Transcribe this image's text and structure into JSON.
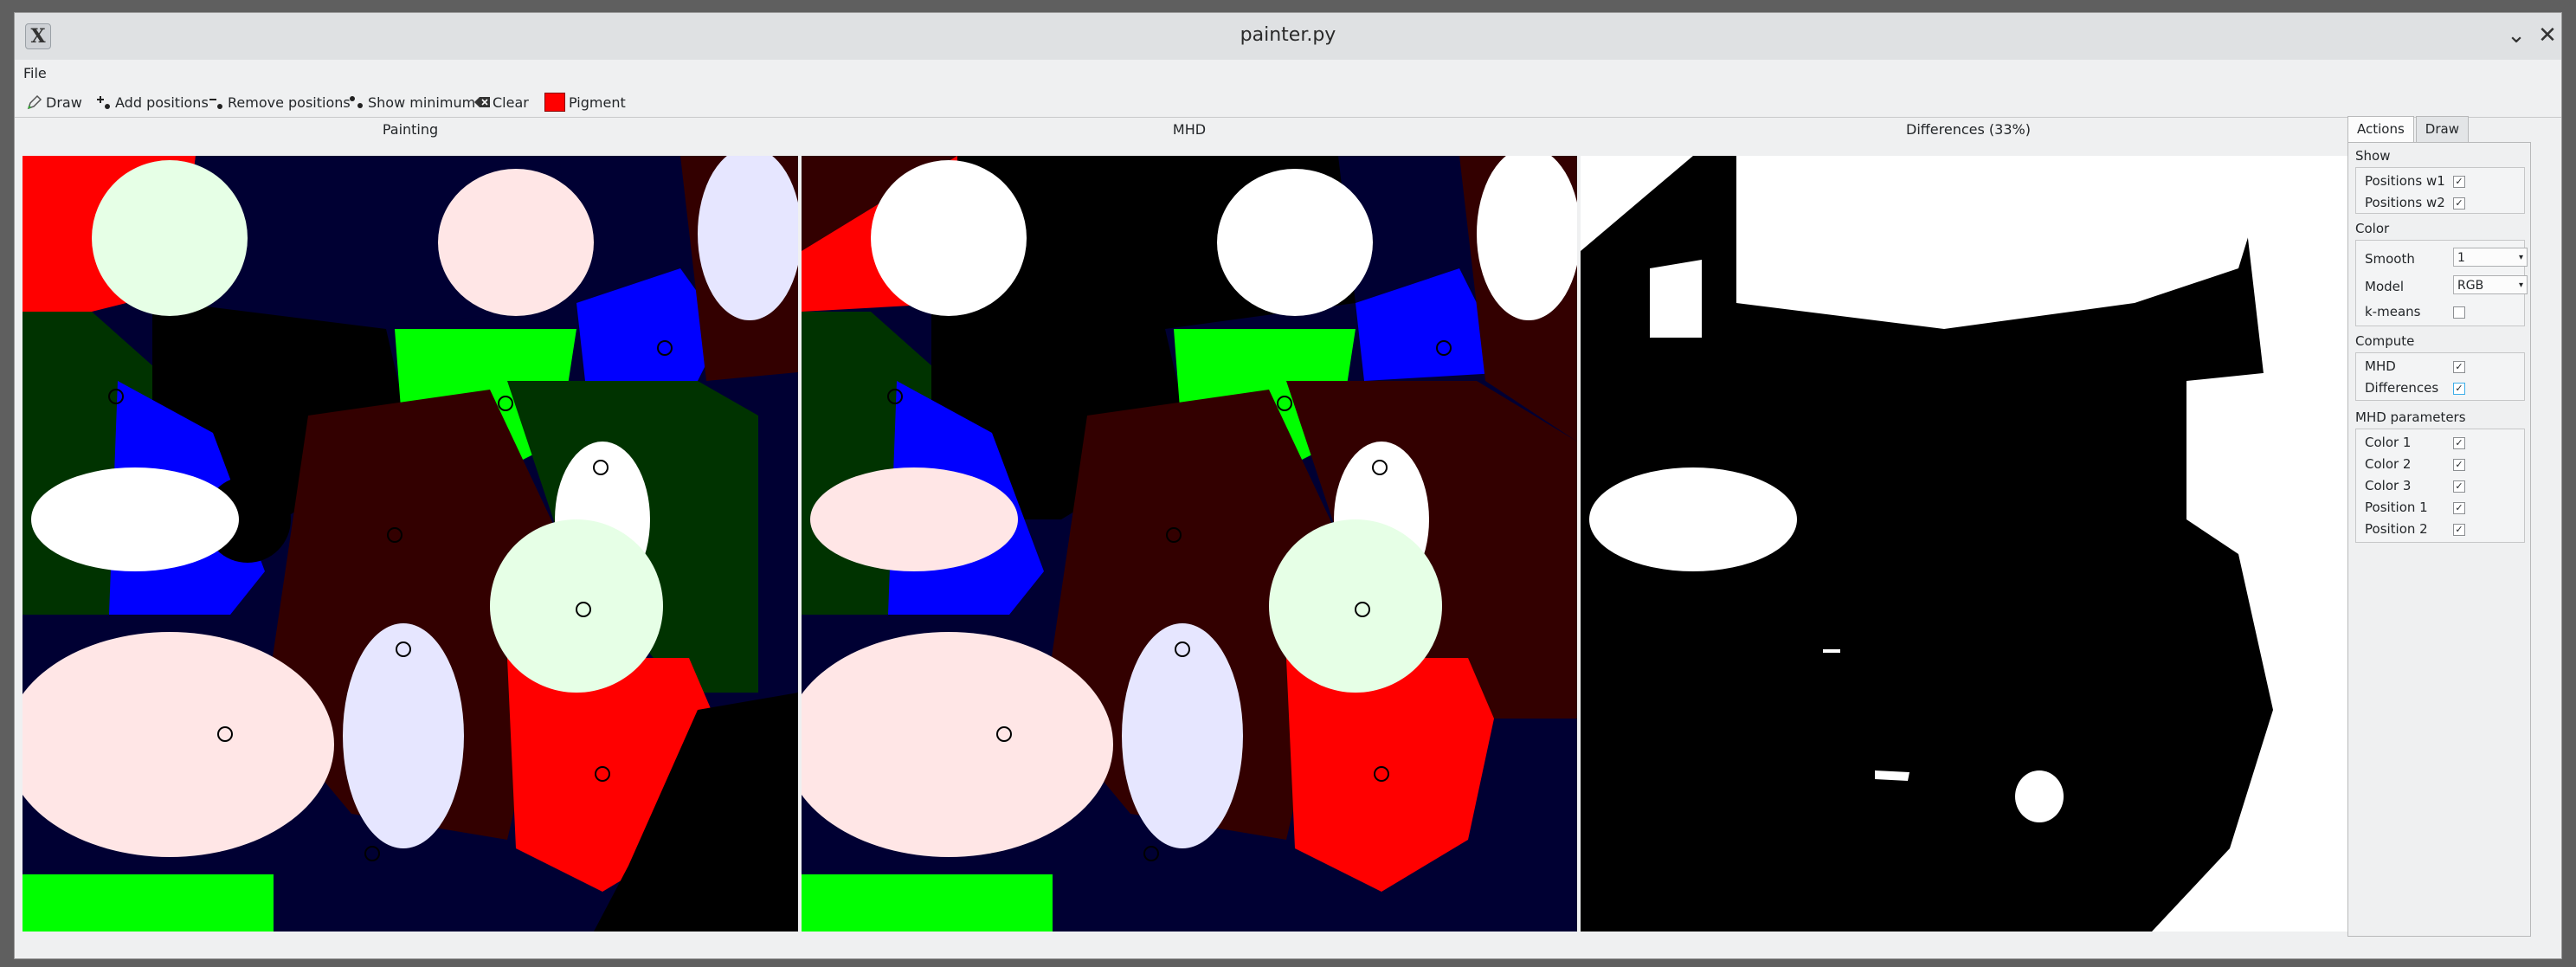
{
  "window": {
    "title": "painter.py",
    "minimize_icon": "chevron-down-icon",
    "close_icon": "close-icon"
  },
  "menu": {
    "file": "File"
  },
  "toolbar": {
    "draw": "Draw",
    "add_positions": "Add positions",
    "remove_positions": "Remove positions",
    "show_minimum": "Show minimum",
    "clear": "Clear",
    "pigment": "Pigment",
    "pigment_color": "#ff0000"
  },
  "panels": {
    "painting": "Painting",
    "mhd": "MHD",
    "differences": "Differences (33%)"
  },
  "sidebar": {
    "tabs": [
      "Actions",
      "Draw"
    ],
    "show": {
      "title": "Show",
      "positions_w1": "Positions w1",
      "positions_w1_checked": true,
      "positions_w2": "Positions w2",
      "positions_w2_checked": true
    },
    "color": {
      "title": "Color",
      "smooth_label": "Smooth",
      "smooth_value": "1",
      "model_label": "Model",
      "model_value": "RGB",
      "kmeans_label": "k-means",
      "kmeans_checked": false
    },
    "compute": {
      "title": "Compute",
      "mhd_label": "MHD",
      "mhd_checked": true,
      "differences_label": "Differences",
      "differences_checked": true
    },
    "mhd_params": {
      "title": "MHD parameters",
      "color1": "Color 1",
      "color2": "Color 2",
      "color3": "Color 3",
      "position1": "Position 1",
      "position2": "Position 2"
    }
  },
  "colors": {
    "red": "#ff0000",
    "dark_green": "#003300",
    "blue": "#0000ff",
    "green": "#00ff00",
    "navy": "#000033",
    "maroon": "#330000",
    "black": "#000000",
    "pale_green": "#e6ffe6",
    "pale_pink": "#ffe6e6",
    "lavender": "#e6e6ff",
    "white": "#ffffff"
  }
}
